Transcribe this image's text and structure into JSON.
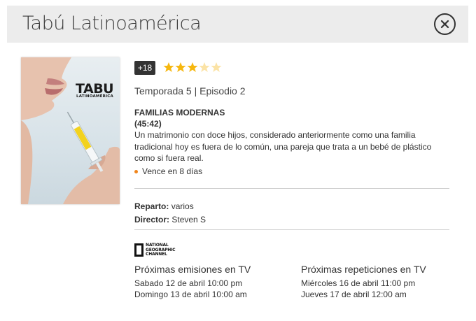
{
  "header": {
    "title": "Tabú Latinoamérica"
  },
  "icons": {
    "close": "close-icon",
    "star": "star-icon",
    "brand": "national-geographic-logo"
  },
  "colors": {
    "star_full": "#f6b70f",
    "star_empty": "#fbe3a6",
    "expire_dot": "#f0851b"
  },
  "poster": {
    "logo_main": "TABU",
    "logo_sub": "LATINOAMÉRICA"
  },
  "rating": {
    "age": "+18",
    "stars": 3,
    "max_stars": 5
  },
  "episode": {
    "season_line": "Temporada 5 | Episodio 2",
    "title": "FAMILIAS MODERNAS",
    "duration": "(45:42)",
    "description": "Un matrimonio con doce hijos, considerado anteriormente como una familia tradicional hoy es fuera de lo común, una pareja que trata a un bebé de plástico como si fuera real.",
    "expires": "Vence en 8 días"
  },
  "credits": {
    "cast_label": "Reparto:",
    "cast_value": "varios",
    "director_label": "Director:",
    "director_value": "Steven S"
  },
  "channel": {
    "logo_line1": "NATIONAL",
    "logo_line2": "GEOGRAPHIC",
    "logo_line3": "CHANNEL"
  },
  "schedule": {
    "emissions_title": "Próximas emisiones en TV",
    "emissions": [
      "Sabado 12 de abril 10:00 pm",
      "Domingo 13 de abril 10:00 am"
    ],
    "repeats_title": "Próximas repeticiones en TV",
    "repeats": [
      "Miércoles 16 de abril 11:00 pm",
      "Jueves 17 de abril 12:00 am"
    ]
  }
}
